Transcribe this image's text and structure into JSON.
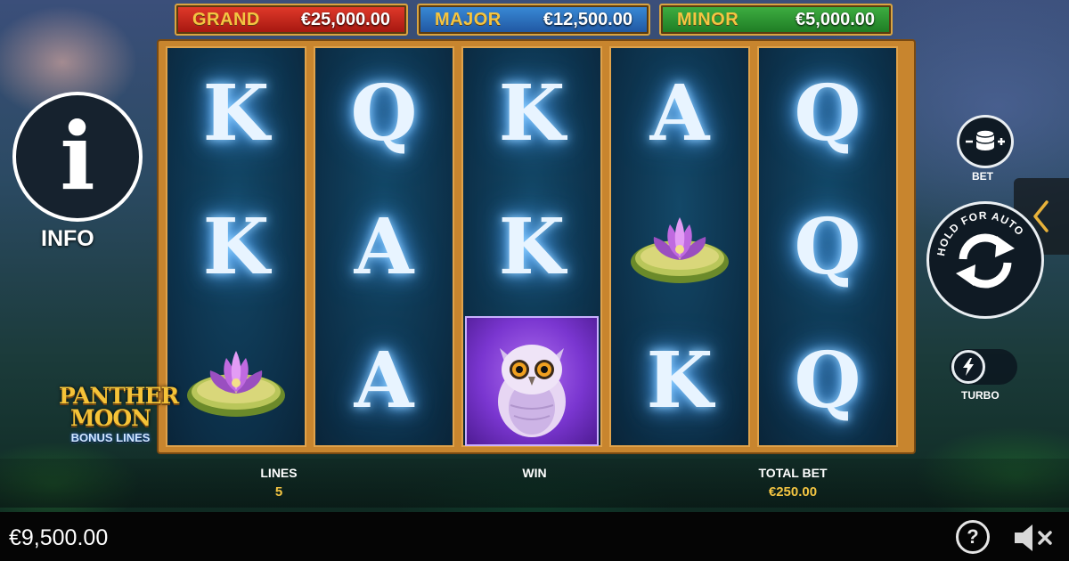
{
  "jackpots": [
    {
      "label": "GRAND",
      "value": "€25,000.00",
      "color": "#c9271b"
    },
    {
      "label": "MAJOR",
      "value": "€12,500.00",
      "color": "#2d70bd"
    },
    {
      "label": "MINOR",
      "value": "€5,000.00",
      "color": "#2f9536"
    }
  ],
  "reels": [
    [
      "K",
      "K",
      "lotus"
    ],
    [
      "Q",
      "A",
      "A"
    ],
    [
      "K",
      "K",
      "owl"
    ],
    [
      "A",
      "lotus",
      "K"
    ],
    [
      "Q",
      "Q",
      "Q"
    ]
  ],
  "left_panel": {
    "info_label": "INFO",
    "info_icon": "info-icon",
    "logo": {
      "line1": "PANTHER",
      "line2": "MOON",
      "line3": "BONUS LINES"
    }
  },
  "right_panel": {
    "bet_label": "BET",
    "bet_icon": "coin-stack-icon",
    "spin_ring_text": "HOLD FOR AUTO",
    "spin_icon": "spin-arrows-icon",
    "turbo_label": "TURBO",
    "turbo_icon": "lightning-icon",
    "side_tab_icon": "chevron-left-icon"
  },
  "stats": {
    "lines_label": "LINES",
    "lines_value": "5",
    "win_label": "WIN",
    "win_value": "",
    "total_bet_label": "TOTAL BET",
    "total_bet_value": "€250.00"
  },
  "bottom": {
    "balance": "€9,500.00",
    "help_icon": "question-icon",
    "help_glyph": "?",
    "sound_icon": "speaker-muted-icon"
  },
  "colors": {
    "gold": "#f4c542",
    "frame": "#c8852e",
    "reel_bg": "#0c2f48"
  }
}
